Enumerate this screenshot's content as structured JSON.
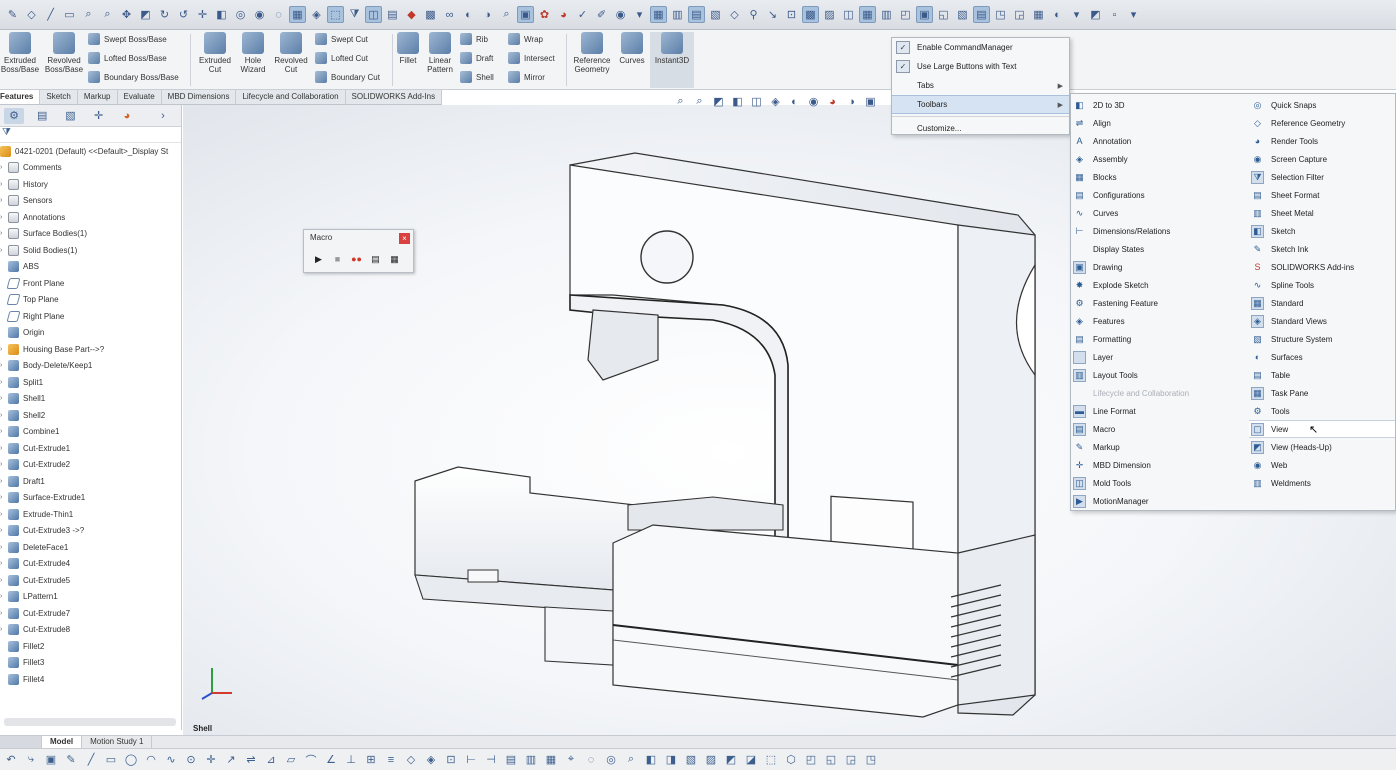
{
  "ribbon": {
    "big_buttons": [
      {
        "label1": "Extruded",
        "label2": "Boss/Base"
      },
      {
        "label1": "Revolved",
        "label2": "Boss/Base"
      },
      {
        "label1": "Extruded",
        "label2": "Cut"
      },
      {
        "label1": "Hole",
        "label2": "Wizard"
      },
      {
        "label1": "Revolved",
        "label2": "Cut"
      },
      {
        "label1": "Fillet",
        "label2": ""
      },
      {
        "label1": "Linear",
        "label2": "Pattern"
      },
      {
        "label1": "Reference",
        "label2": "Geometry"
      },
      {
        "label1": "Curves",
        "label2": ""
      },
      {
        "label1": "Instant3D",
        "label2": ""
      }
    ],
    "small_buttons": [
      "Swept Boss/Base",
      "Lofted Boss/Base",
      "Boundary Boss/Base",
      "Swept Cut",
      "Lofted Cut",
      "Boundary Cut",
      "Rib",
      "Draft",
      "Shell",
      "Wrap",
      "Intersect",
      "Mirror"
    ]
  },
  "tabs": [
    "Features",
    "Sketch",
    "Markup",
    "Evaluate",
    "MBD Dimensions",
    "Lifecycle and Collaboration",
    "SOLIDWORKS Add-Ins"
  ],
  "tree": {
    "root": "0421-0201 (Default) <<Default>_Display St",
    "items": [
      "Comments",
      "History",
      "Sensors",
      "Annotations",
      "Surface Bodies(1)",
      "Solid Bodies(1)",
      "ABS",
      "Front Plane",
      "Top Plane",
      "Right Plane",
      "Origin",
      "Housing Base Part-->?",
      "Body-Delete/Keep1",
      "Split1",
      "Shell1",
      "Shell2",
      "Combine1",
      "Cut-Extrude1",
      "Cut-Extrude2",
      "Draft1",
      "Surface-Extrude1",
      "Extrude-Thin1",
      "Cut-Extrude3 ->?",
      "DeleteFace1",
      "Cut-Extrude4",
      "Cut-Extrude5",
      "LPattern1",
      "Cut-Extrude7",
      "Cut-Extrude8",
      "Fillet2",
      "Fillet3",
      "Fillet4"
    ]
  },
  "macro": {
    "title": "Macro",
    "close": "×"
  },
  "context_menu": {
    "enable_commandmanager": "Enable CommandManager",
    "large_buttons": "Use Large Buttons with Text",
    "tabs": "Tabs",
    "toolbars": "Toolbars",
    "customize": "Customize..."
  },
  "toolbars_col1": [
    "2D to 3D",
    "Align",
    "Annotation",
    "Assembly",
    "Blocks",
    "Configurations",
    "Curves",
    "Dimensions/Relations",
    "Display States",
    "Drawing",
    "Explode Sketch",
    "Fastening Feature",
    "Features",
    "Formatting",
    "Layer",
    "Layout Tools",
    "Lifecycle and Collaboration",
    "Line Format",
    "Macro",
    "Markup",
    "MBD Dimension",
    "Mold Tools",
    "MotionManager"
  ],
  "toolbars_col2": [
    "Quick Snaps",
    "Reference Geometry",
    "Render Tools",
    "Screen Capture",
    "Selection Filter",
    "Sheet Format",
    "Sheet Metal",
    "Sketch",
    "Sketch Ink",
    "SOLIDWORKS Add-ins",
    "Spline Tools",
    "Standard",
    "Standard Views",
    "Structure System",
    "Surfaces",
    "Table",
    "Task Pane",
    "Tools",
    "View",
    "View (Heads-Up)",
    "Web",
    "Weldments"
  ],
  "viewport": {
    "feature_label": "Shell"
  },
  "bottom_tabs": [
    "",
    "Model",
    "Motion Study 1"
  ]
}
